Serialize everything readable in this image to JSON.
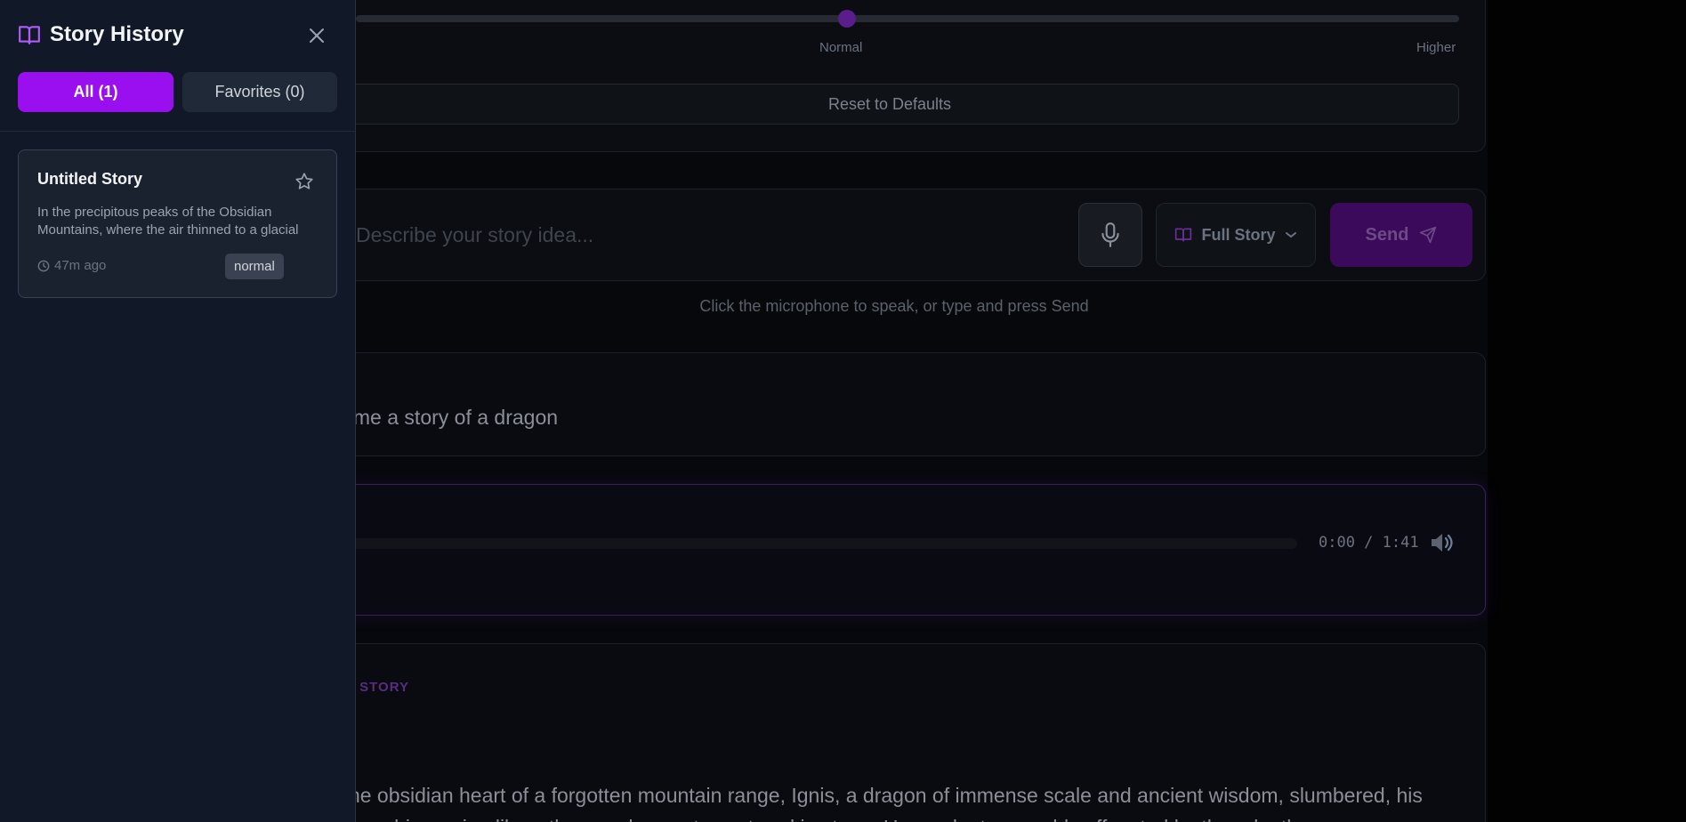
{
  "sidebar": {
    "title": "Story History",
    "tabs": {
      "all": "All (1)",
      "favorites": "Favorites (0)"
    },
    "stories": [
      {
        "title": "Untitled Story",
        "excerpt_line1": "In the precipitous peaks of the Obsidian",
        "excerpt_line2": "Mountains, where the air thinned to a glacial",
        "time": "47m ago",
        "badge": "normal"
      }
    ]
  },
  "settings": {
    "slider_mid_label": "Normal",
    "slider_high_label": "Higher",
    "reset_label": "Reset to Defaults"
  },
  "composer": {
    "placeholder": "Describe your story idea...",
    "mode_label": "Full Story",
    "send_label": "Send",
    "hint": "Click the microphone to speak, or type and press Send"
  },
  "prompt": {
    "text": "Tell me a story of a dragon"
  },
  "audio": {
    "time": "0:00 / 1:41",
    "progress": 0
  },
  "story": {
    "tag": "STORY",
    "text": "In the obsidian heart of a forgotten mountain range, Ignis, a dragon of immense scale and ancient wisdom, slumbered, his scales shimmering like a thousand sunsets captured in stone. He awoke to a world suffocated by the relentless"
  },
  "colors": {
    "accent": "#9a0ff0",
    "sidebar_bg": "#111827",
    "page_bg": "#07080c"
  }
}
